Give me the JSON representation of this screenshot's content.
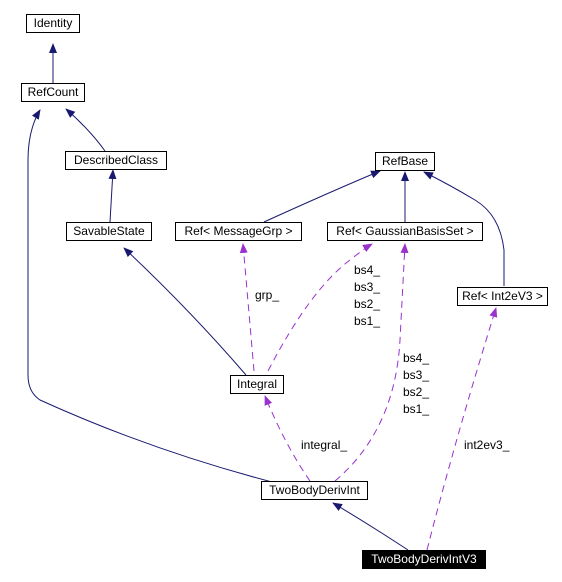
{
  "diagram": {
    "type": "class-collaboration-graph",
    "colors": {
      "inheritance_edge": "#191970",
      "usage_edge": "#9a32cd",
      "node_border": "#000000",
      "current_node_fill": "#000000",
      "current_node_text": "#ffffff"
    },
    "nodes": [
      {
        "id": "identity",
        "label": "Identity"
      },
      {
        "id": "refcount",
        "label": "RefCount"
      },
      {
        "id": "describedclass",
        "label": "DescribedClass"
      },
      {
        "id": "savablestate",
        "label": "SavableState"
      },
      {
        "id": "refbase",
        "label": "RefBase"
      },
      {
        "id": "ref-messagegrp",
        "label": "Ref< MessageGrp >"
      },
      {
        "id": "ref-gaussianbasisset",
        "label": "Ref< GaussianBasisSet >"
      },
      {
        "id": "ref-int2ev3",
        "label": "Ref< Int2eV3 >"
      },
      {
        "id": "integral",
        "label": "Integral"
      },
      {
        "id": "twobodyderivint",
        "label": "TwoBodyDerivInt"
      },
      {
        "id": "twobodyderivintv3",
        "label": "TwoBodyDerivIntV3",
        "current": true
      }
    ],
    "edges": [
      {
        "from": "refcount",
        "to": "identity",
        "kind": "inheritance"
      },
      {
        "from": "describedclass",
        "to": "refcount",
        "kind": "inheritance"
      },
      {
        "from": "savablestate",
        "to": "describedclass",
        "kind": "inheritance"
      },
      {
        "from": "integral",
        "to": "savablestate",
        "kind": "inheritance"
      },
      {
        "from": "twobodyderivint",
        "to": "refcount",
        "kind": "inheritance"
      },
      {
        "from": "ref-messagegrp",
        "to": "refbase",
        "kind": "inheritance"
      },
      {
        "from": "ref-gaussianbasisset",
        "to": "refbase",
        "kind": "inheritance"
      },
      {
        "from": "ref-int2ev3",
        "to": "refbase",
        "kind": "inheritance"
      },
      {
        "from": "twobodyderivintv3",
        "to": "twobodyderivint",
        "kind": "inheritance"
      },
      {
        "from": "integral",
        "to": "ref-messagegrp",
        "kind": "usage",
        "label": "grp_"
      },
      {
        "from": "integral",
        "to": "ref-gaussianbasisset",
        "kind": "usage",
        "label": "bs4_\nbs3_\nbs2_\nbs1_"
      },
      {
        "from": "twobodyderivint",
        "to": "ref-gaussianbasisset",
        "kind": "usage",
        "label": "bs4_\nbs3_\nbs2_\nbs1_"
      },
      {
        "from": "twobodyderivint",
        "to": "integral",
        "kind": "usage",
        "label": "integral_"
      },
      {
        "from": "twobodyderivintv3",
        "to": "ref-int2ev3",
        "kind": "usage",
        "label": "int2ev3_"
      }
    ]
  }
}
